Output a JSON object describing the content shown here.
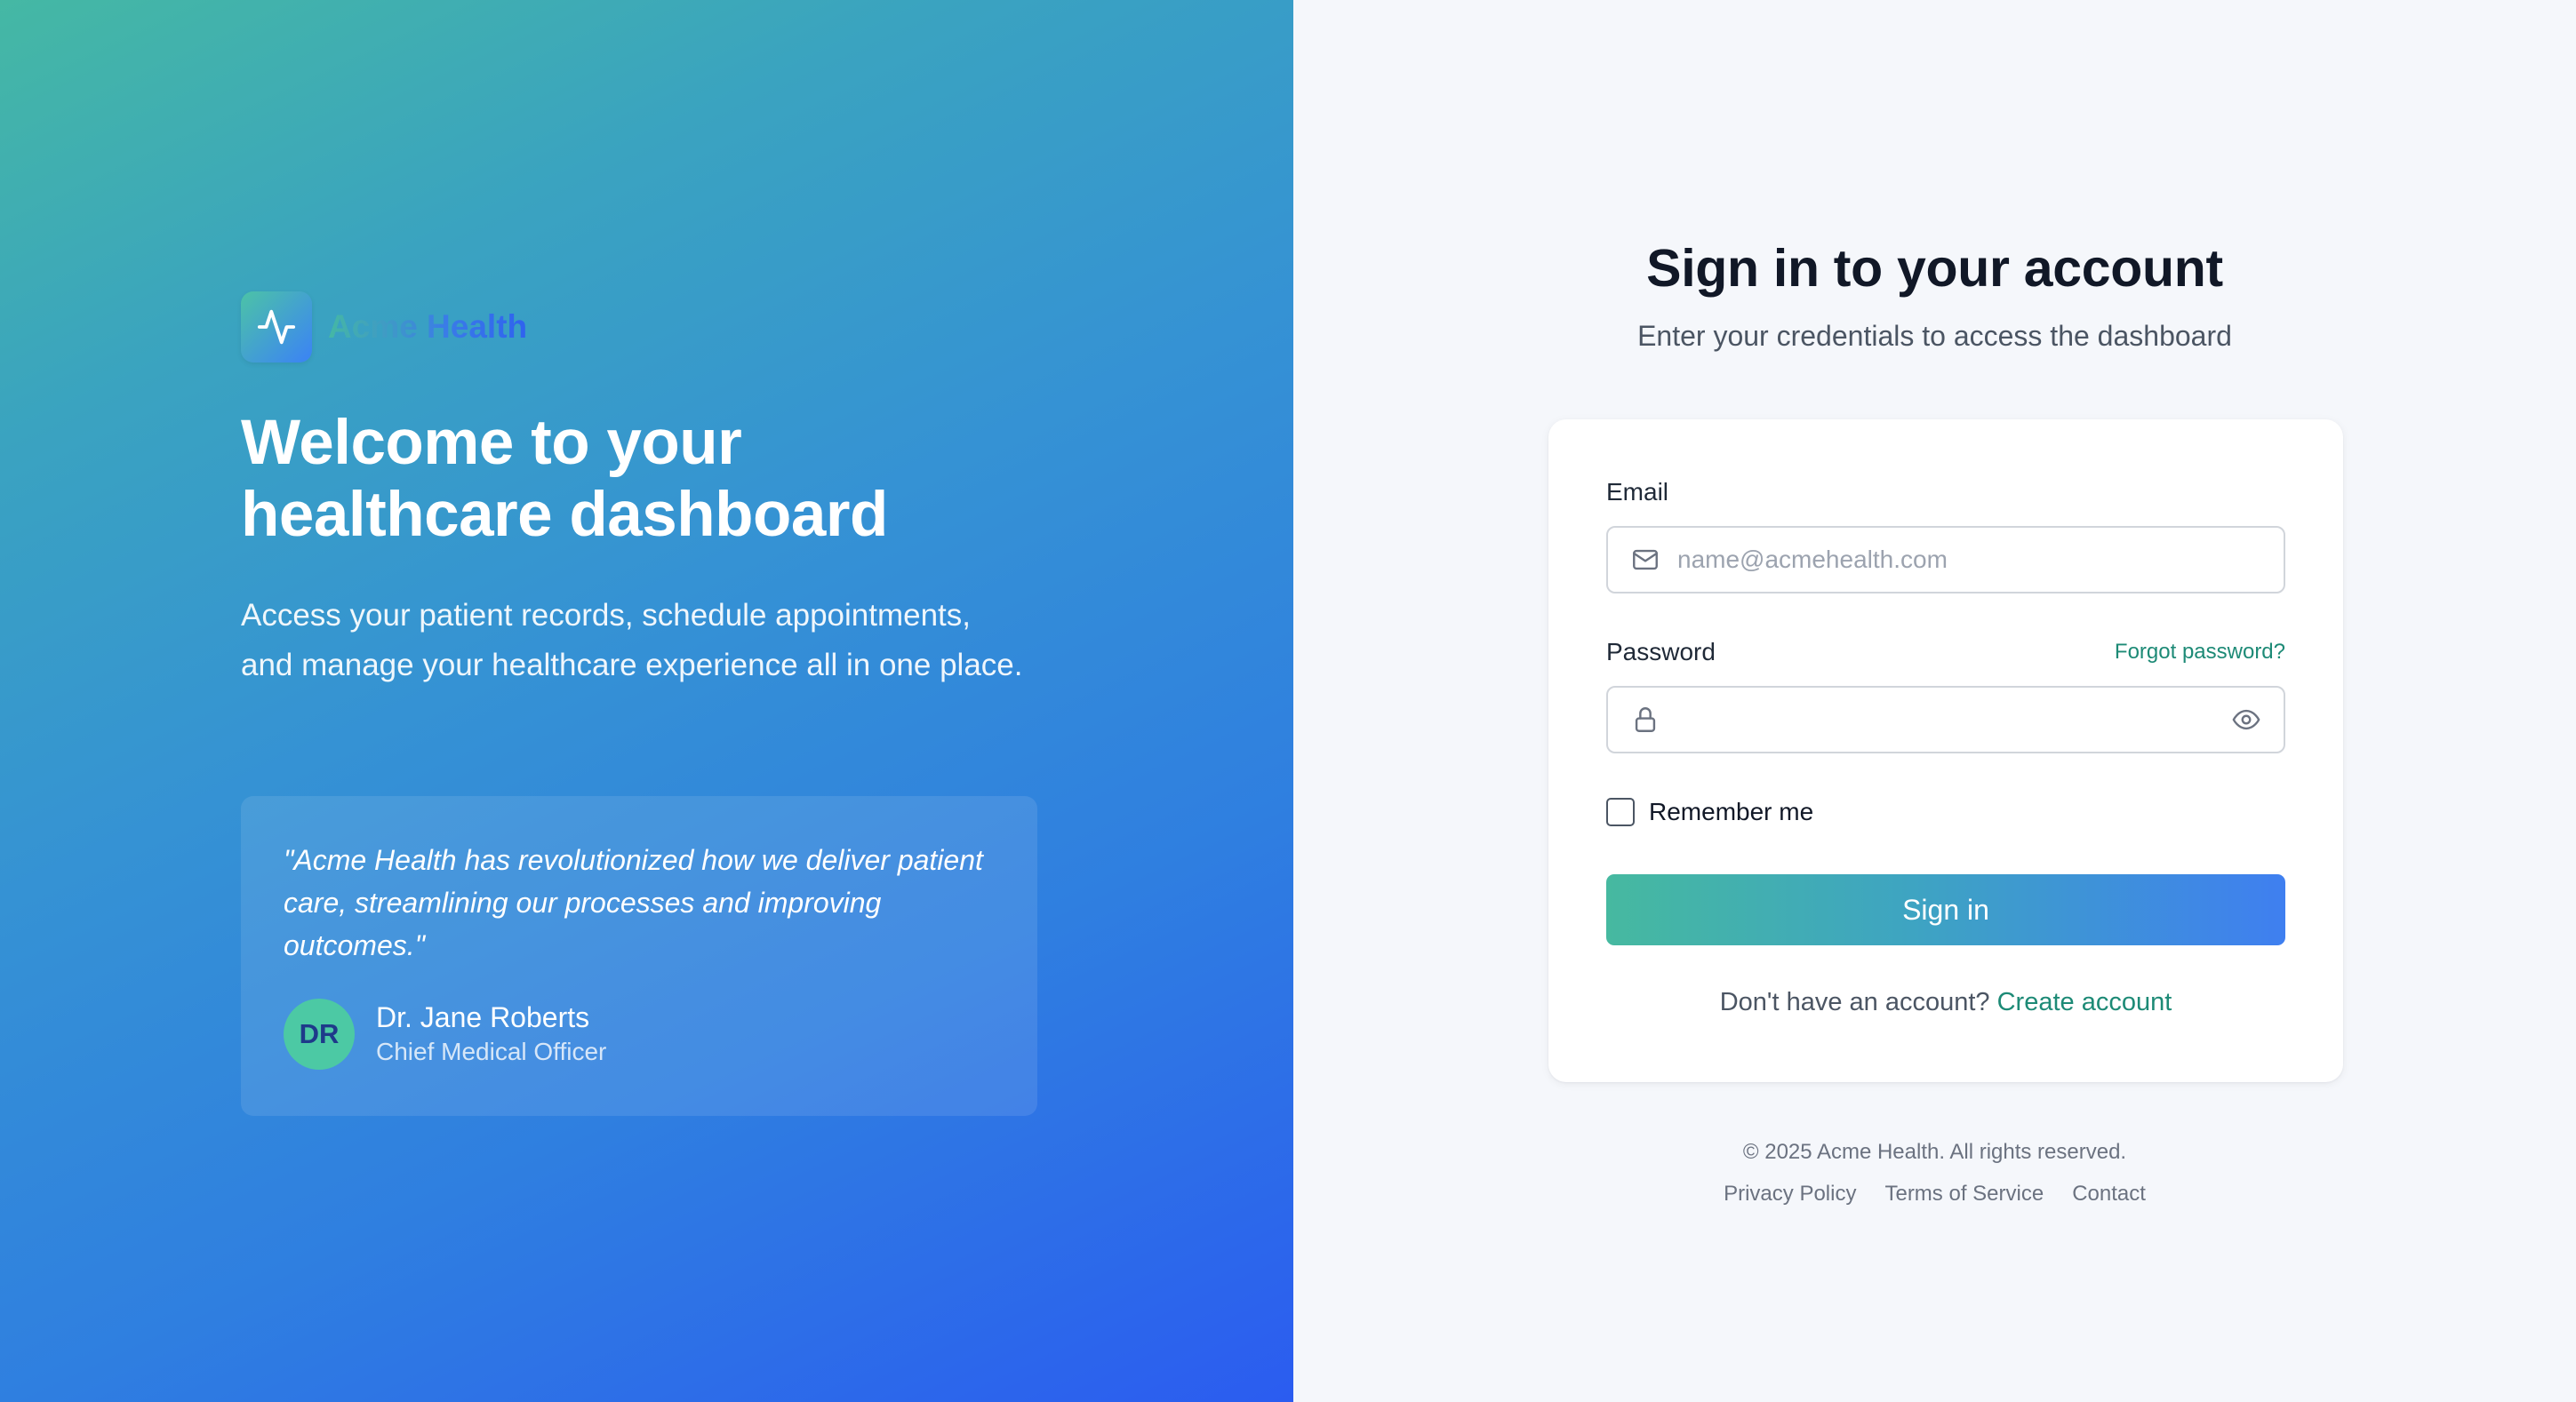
{
  "hero": {
    "brand_name": "Acme Health",
    "brand_icon": "activity-pulse-icon",
    "title_line1": "Welcome to your",
    "title_line2": "healthcare dashboard",
    "description": "Access your patient records, schedule appointments, and manage your healthcare experience all in one place.",
    "testimonial": {
      "quote": "\"Acme Health has revolutionized how we deliver patient care, streamlining our processes and improving outcomes.\"",
      "avatar_initials": "DR",
      "author_name": "Dr. Jane Roberts",
      "author_role": "Chief Medical Officer"
    }
  },
  "form": {
    "title": "Sign in to your account",
    "subtitle": "Enter your credentials to access the dashboard",
    "email": {
      "label": "Email",
      "placeholder": "name@acmehealth.com",
      "value": "",
      "icon": "mail-icon"
    },
    "password": {
      "label": "Password",
      "forgot_label": "Forgot password?",
      "value": "",
      "icon": "lock-icon",
      "toggle_icon": "eye-icon"
    },
    "remember_label": "Remember me",
    "remember_checked": false,
    "submit_label": "Sign in",
    "signup_prompt": "Don't have an account?",
    "signup_link": "Create account"
  },
  "footer": {
    "copyright": "© 2025 Acme Health. All rights reserved.",
    "links": [
      "Privacy Policy",
      "Terms of Service",
      "Contact"
    ]
  },
  "colors": {
    "accent_teal": "#1d8a76",
    "gradient_start": "#45b8a4",
    "gradient_end": "#2b5cf0",
    "avatar_bg": "#4cc9a4"
  }
}
